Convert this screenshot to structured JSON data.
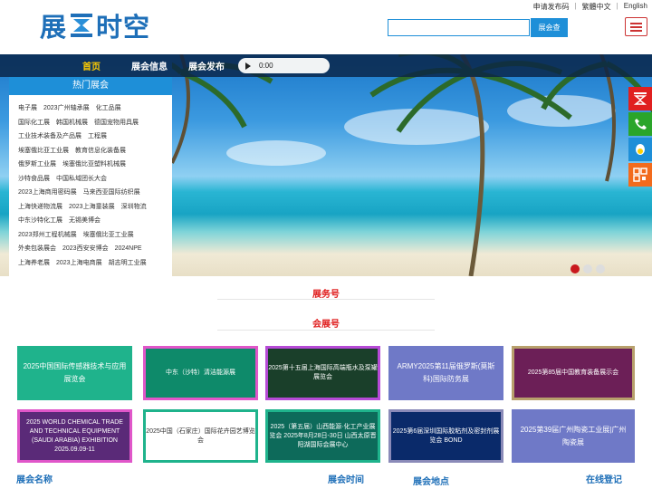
{
  "logo": {
    "text_left": "展",
    "text_right": "时空"
  },
  "toplinks": {
    "publish": "申请发布码",
    "traditional": "繁體中文",
    "english": "English"
  },
  "search": {
    "placeholder": "",
    "button": "展会查"
  },
  "nav": {
    "home": "首页",
    "info": "展会信息",
    "publish": "展会发布"
  },
  "audio": {
    "time": "0:00"
  },
  "hot": {
    "title": "热门展会",
    "rows": [
      [
        "电子展",
        "2023广州轴承展",
        "化工品展"
      ],
      [
        "国际化工展",
        "韩国机械展",
        "德国宠物用具展"
      ],
      [
        "工业技术装备及产品展",
        "工程展"
      ],
      [
        "埃塞俄比亚工业展",
        "教育信息化装备展"
      ],
      [
        "俄罗斯工业展",
        "埃塞俄比亚塑料机械展"
      ],
      [
        "沙特食品展",
        "中国私域团长大会"
      ],
      [
        "2023上海商用密码展",
        "马来西亚国际纺织展"
      ],
      [
        "上海快递物流展",
        "2023上海童装展",
        "深圳物流"
      ],
      [
        "中东沙特化工展",
        "无锡美博会"
      ],
      [
        "2023郑州工程机械展",
        "埃塞俄比亚工业展"
      ],
      [
        "外卖包装展会",
        "2023西安安博会",
        "2024NPE"
      ],
      [
        "上海养老展",
        "2023上海电商展",
        "胡志明工业展"
      ]
    ]
  },
  "sections": {
    "service": "展务号",
    "exhibition": "会展号"
  },
  "cards_row1": [
    {
      "kind": "text",
      "text": "2025中国国际传感器技术与应用展览会",
      "bg": "#1fb38c"
    },
    {
      "kind": "img",
      "text": "中东（沙特）清洁能源展",
      "bg": "#0e8a6a",
      "border": "#e056c9"
    },
    {
      "kind": "img",
      "text": "2025第十五届上海国际高端瓶水及泵罐展览会",
      "bg": "#1a3f2a",
      "border": "#b64ad6"
    },
    {
      "kind": "text",
      "text": "ARMY2025第11届俄罗斯(莫斯科)国际防务展",
      "bg": "#6f79c7"
    },
    {
      "kind": "img",
      "text": "2025第85届中国教育装备展示会",
      "bg": "#6c1f57",
      "border": "#b8a06c"
    }
  ],
  "cards_row2": [
    {
      "kind": "img",
      "text": "2025 WORLD CHEMICAL TRADE AND TECHNICAL EQUIPMENT (SAUDI ARABIA) EXHIBITION 2025.09.09-11",
      "bg": "#5a2a78",
      "border": "#e056c9"
    },
    {
      "kind": "img",
      "text": "2025中国（石家庄）国际花卉园艺博览会",
      "bg": "#ffffff",
      "border": "#1fb38c"
    },
    {
      "kind": "img",
      "text": "2025（第五届）山西能源·化工产业展览会 2025年8月28日-30日 山西太原晋阳湖国际会展中心",
      "bg": "#0d6a5a",
      "border": "#1fb38c"
    },
    {
      "kind": "img",
      "text": "2025第6届深圳国际胶粘剂及密封剂展览会 BOND",
      "bg": "#0a2a6a",
      "border": "#8a8ab8"
    },
    {
      "kind": "text",
      "text": "2025第39届广州陶瓷工业展|广州陶瓷展",
      "bg": "#6f79c7"
    }
  ],
  "bottom": {
    "name": "展会名称",
    "time": "展会时间",
    "place": "展会地点",
    "login": "在线登记"
  },
  "colors": {
    "brand": "#1e6fb8",
    "accent": "#e02020",
    "search": "#1e8fd8"
  },
  "side_icons": [
    "top-icon",
    "phone-icon",
    "qq-icon",
    "qrcode-icon"
  ]
}
